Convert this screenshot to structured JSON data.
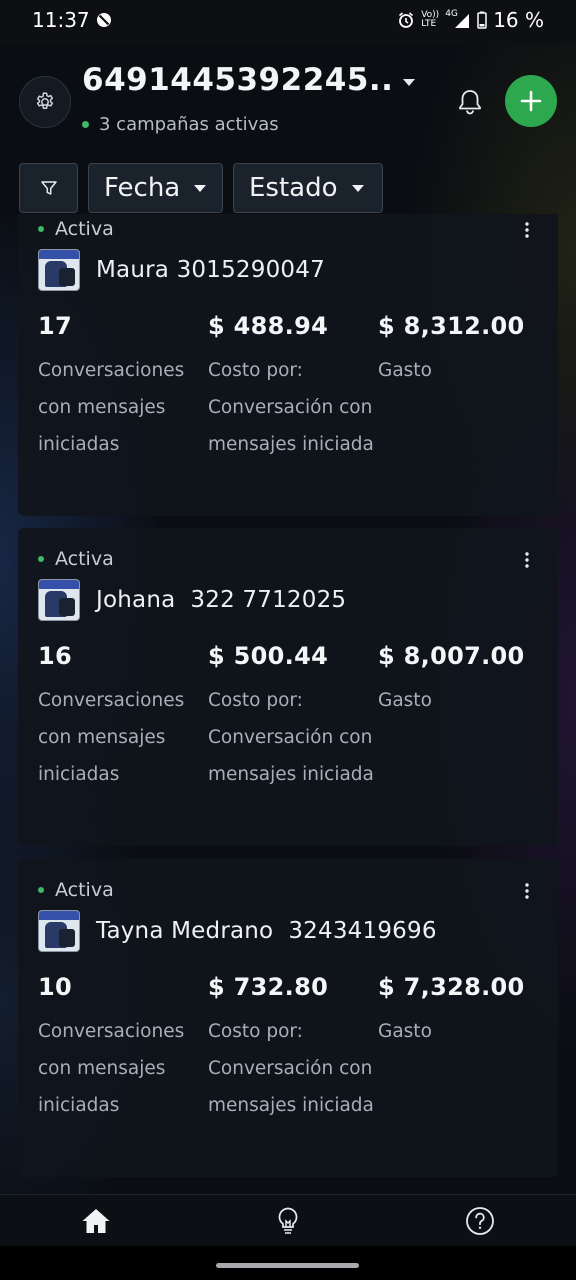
{
  "status_bar": {
    "time": "11:37",
    "battery_pct": "16 %",
    "network": "4G",
    "volte_line1": "Vo))",
    "volte_line2": "LTE"
  },
  "header": {
    "account_title": "6491445392245..",
    "active_campaigns": "3 campañas activas"
  },
  "filters": {
    "date_label": "Fecha",
    "status_label": "Estado"
  },
  "campaigns": [
    {
      "status": "Activa",
      "name": "Maura 3015290047",
      "results": "17",
      "results_label": "Conversaciones con mensajes iniciadas",
      "cost_per": "$ 488.94",
      "cost_per_label": "Costo por: Conversación con mensajes iniciada",
      "spend": "$ 8,312.00",
      "spend_label": "Gasto"
    },
    {
      "status": "Activa",
      "name": "Johana  322 7712025",
      "results": "16",
      "results_label": "Conversaciones con mensajes iniciadas",
      "cost_per": "$ 500.44",
      "cost_per_label": "Costo por: Conversación con mensajes iniciada",
      "spend": "$ 8,007.00",
      "spend_label": "Gasto"
    },
    {
      "status": "Activa",
      "name": "Tayna Medrano  3243419696",
      "results": "10",
      "results_label": "Conversaciones con mensajes iniciadas",
      "cost_per": "$ 732.80",
      "cost_per_label": "Costo por: Conversación con mensajes iniciada",
      "spend": "$ 7,328.00",
      "spend_label": "Gasto"
    }
  ],
  "bottom_nav": {
    "items": [
      {
        "icon": "home-icon"
      },
      {
        "icon": "lightbulb-icon"
      },
      {
        "icon": "help-icon"
      }
    ]
  },
  "colors": {
    "accent_green": "#2ea84e",
    "status_dot": "#3fb867",
    "background": "#0a0d12"
  }
}
